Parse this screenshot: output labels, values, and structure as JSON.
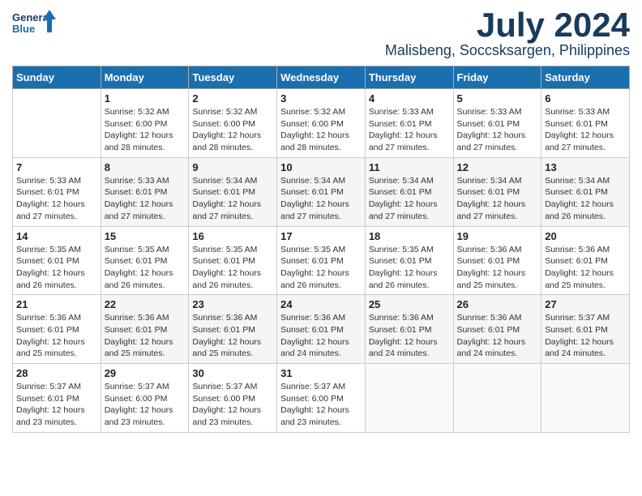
{
  "header": {
    "logo_line1": "General",
    "logo_line2": "Blue",
    "month": "July 2024",
    "location": "Malisbeng, Soccsksargen, Philippines"
  },
  "days_of_week": [
    "Sunday",
    "Monday",
    "Tuesday",
    "Wednesday",
    "Thursday",
    "Friday",
    "Saturday"
  ],
  "weeks": [
    [
      {
        "day": "",
        "text": ""
      },
      {
        "day": "1",
        "text": "Sunrise: 5:32 AM\nSunset: 6:00 PM\nDaylight: 12 hours\nand 28 minutes."
      },
      {
        "day": "2",
        "text": "Sunrise: 5:32 AM\nSunset: 6:00 PM\nDaylight: 12 hours\nand 28 minutes."
      },
      {
        "day": "3",
        "text": "Sunrise: 5:32 AM\nSunset: 6:00 PM\nDaylight: 12 hours\nand 28 minutes."
      },
      {
        "day": "4",
        "text": "Sunrise: 5:33 AM\nSunset: 6:01 PM\nDaylight: 12 hours\nand 27 minutes."
      },
      {
        "day": "5",
        "text": "Sunrise: 5:33 AM\nSunset: 6:01 PM\nDaylight: 12 hours\nand 27 minutes."
      },
      {
        "day": "6",
        "text": "Sunrise: 5:33 AM\nSunset: 6:01 PM\nDaylight: 12 hours\nand 27 minutes."
      }
    ],
    [
      {
        "day": "7",
        "text": "Sunrise: 5:33 AM\nSunset: 6:01 PM\nDaylight: 12 hours\nand 27 minutes."
      },
      {
        "day": "8",
        "text": "Sunrise: 5:33 AM\nSunset: 6:01 PM\nDaylight: 12 hours\nand 27 minutes."
      },
      {
        "day": "9",
        "text": "Sunrise: 5:34 AM\nSunset: 6:01 PM\nDaylight: 12 hours\nand 27 minutes."
      },
      {
        "day": "10",
        "text": "Sunrise: 5:34 AM\nSunset: 6:01 PM\nDaylight: 12 hours\nand 27 minutes."
      },
      {
        "day": "11",
        "text": "Sunrise: 5:34 AM\nSunset: 6:01 PM\nDaylight: 12 hours\nand 27 minutes."
      },
      {
        "day": "12",
        "text": "Sunrise: 5:34 AM\nSunset: 6:01 PM\nDaylight: 12 hours\nand 27 minutes."
      },
      {
        "day": "13",
        "text": "Sunrise: 5:34 AM\nSunset: 6:01 PM\nDaylight: 12 hours\nand 26 minutes."
      }
    ],
    [
      {
        "day": "14",
        "text": "Sunrise: 5:35 AM\nSunset: 6:01 PM\nDaylight: 12 hours\nand 26 minutes."
      },
      {
        "day": "15",
        "text": "Sunrise: 5:35 AM\nSunset: 6:01 PM\nDaylight: 12 hours\nand 26 minutes."
      },
      {
        "day": "16",
        "text": "Sunrise: 5:35 AM\nSunset: 6:01 PM\nDaylight: 12 hours\nand 26 minutes."
      },
      {
        "day": "17",
        "text": "Sunrise: 5:35 AM\nSunset: 6:01 PM\nDaylight: 12 hours\nand 26 minutes."
      },
      {
        "day": "18",
        "text": "Sunrise: 5:35 AM\nSunset: 6:01 PM\nDaylight: 12 hours\nand 26 minutes."
      },
      {
        "day": "19",
        "text": "Sunrise: 5:36 AM\nSunset: 6:01 PM\nDaylight: 12 hours\nand 25 minutes."
      },
      {
        "day": "20",
        "text": "Sunrise: 5:36 AM\nSunset: 6:01 PM\nDaylight: 12 hours\nand 25 minutes."
      }
    ],
    [
      {
        "day": "21",
        "text": "Sunrise: 5:36 AM\nSunset: 6:01 PM\nDaylight: 12 hours\nand 25 minutes."
      },
      {
        "day": "22",
        "text": "Sunrise: 5:36 AM\nSunset: 6:01 PM\nDaylight: 12 hours\nand 25 minutes."
      },
      {
        "day": "23",
        "text": "Sunrise: 5:36 AM\nSunset: 6:01 PM\nDaylight: 12 hours\nand 25 minutes."
      },
      {
        "day": "24",
        "text": "Sunrise: 5:36 AM\nSunset: 6:01 PM\nDaylight: 12 hours\nand 24 minutes."
      },
      {
        "day": "25",
        "text": "Sunrise: 5:36 AM\nSunset: 6:01 PM\nDaylight: 12 hours\nand 24 minutes."
      },
      {
        "day": "26",
        "text": "Sunrise: 5:36 AM\nSunset: 6:01 PM\nDaylight: 12 hours\nand 24 minutes."
      },
      {
        "day": "27",
        "text": "Sunrise: 5:37 AM\nSunset: 6:01 PM\nDaylight: 12 hours\nand 24 minutes."
      }
    ],
    [
      {
        "day": "28",
        "text": "Sunrise: 5:37 AM\nSunset: 6:01 PM\nDaylight: 12 hours\nand 23 minutes."
      },
      {
        "day": "29",
        "text": "Sunrise: 5:37 AM\nSunset: 6:00 PM\nDaylight: 12 hours\nand 23 minutes."
      },
      {
        "day": "30",
        "text": "Sunrise: 5:37 AM\nSunset: 6:00 PM\nDaylight: 12 hours\nand 23 minutes."
      },
      {
        "day": "31",
        "text": "Sunrise: 5:37 AM\nSunset: 6:00 PM\nDaylight: 12 hours\nand 23 minutes."
      },
      {
        "day": "",
        "text": ""
      },
      {
        "day": "",
        "text": ""
      },
      {
        "day": "",
        "text": ""
      }
    ]
  ]
}
